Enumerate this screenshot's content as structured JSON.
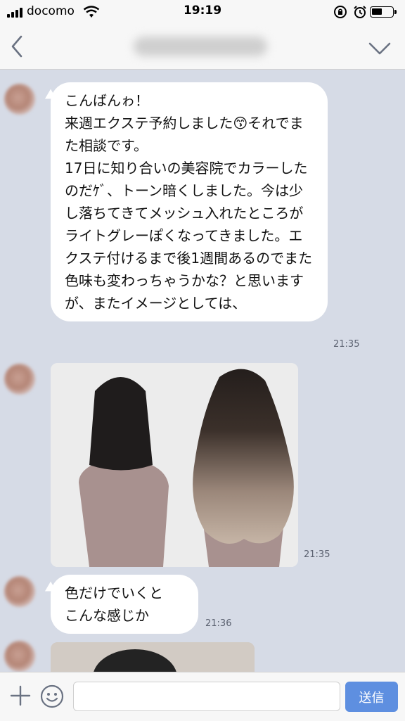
{
  "status_bar": {
    "carrier": "docomo",
    "time": "19:19"
  },
  "header": {
    "title": ""
  },
  "messages": [
    {
      "text": "こんばんゎ！\n来週エクステ予約しました😙それでまた相談です。\n17日に知り合いの美容院でカラーしたのだｹﾞ、トーン暗くしました。今は少し落ちてきてメッシュ入れたところがライトグレーぽくなってきました。エクステ付けるまで後1週間あるのでまた色味も変わっちゃうかな？と思いますが、またイメージとしては、",
      "time": "21:35"
    },
    {
      "type": "image",
      "description": "",
      "time": "21:35"
    },
    {
      "text": "色だけでいくと\nこんな感じか",
      "time": "21:36"
    }
  ],
  "composer": {
    "placeholder": "",
    "send_label": "送信"
  },
  "icons": [
    "back-icon",
    "chevron-down-icon",
    "plus-icon",
    "emoji-icon",
    "wifi-icon",
    "rotation-lock-icon",
    "alarm-icon",
    "battery-icon"
  ],
  "colors": {
    "chat_background": "#d6dbe6",
    "send_button": "#5e8fe0"
  }
}
